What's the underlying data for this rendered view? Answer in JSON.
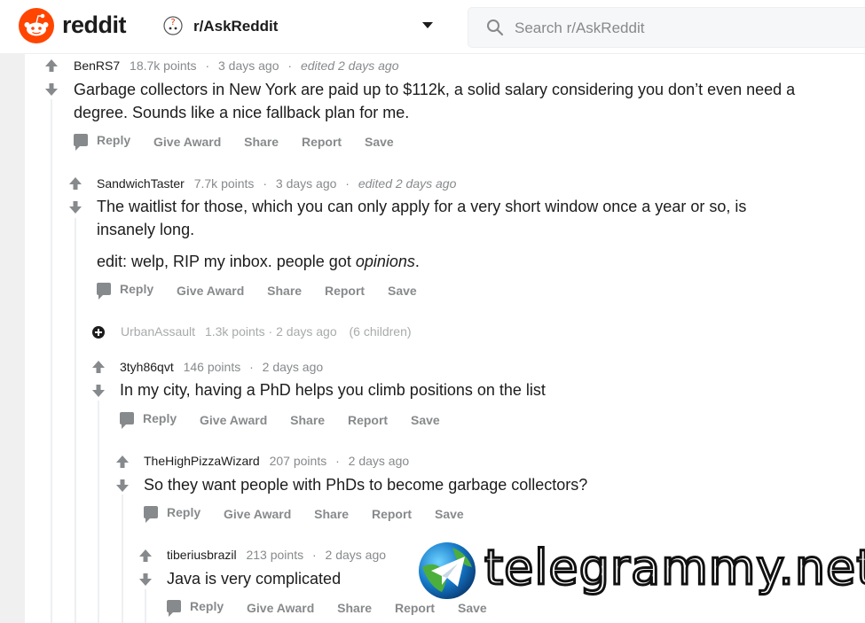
{
  "header": {
    "wordmark": "reddit",
    "subreddit": "r/AskReddit",
    "search_placeholder": "Search r/AskReddit"
  },
  "comments": [
    {
      "author": "BenRS7",
      "points": "18.7k points",
      "time": "3 days ago",
      "edited": "edited 2 days ago",
      "body": "Garbage collectors in New York are paid up to $112k, a solid salary considering you don’t even need a degree. Sounds like a nice fallback plan for me."
    },
    {
      "author": "SandwichTaster",
      "points": "7.7k points",
      "time": "3 days ago",
      "edited": "edited 2 days ago",
      "body": "The waitlist for those, which you can only apply for a very short window once a year or so, is insanely long.",
      "body2_prefix": "edit: welp, RIP my inbox. people got ",
      "body2_em": "opinions",
      "body2_suffix": "."
    },
    {
      "author": "UrbanAssault",
      "points": "1.3k points",
      "time": "2 days ago",
      "children": "(6 children)"
    },
    {
      "author": "3tyh86qvt",
      "points": "146 points",
      "time": "2 days ago",
      "body": "In my city, having a PhD helps you climb positions on the list"
    },
    {
      "author": "TheHighPizzaWizard",
      "points": "207 points",
      "time": "2 days ago",
      "body": "So they want people with PhDs to become garbage collectors?"
    },
    {
      "author": "tiberiusbrazil",
      "points": "213 points",
      "time": "2 days ago",
      "body": "Java is very complicated"
    }
  ],
  "actions": {
    "reply": "Reply",
    "give_award": "Give Award",
    "share": "Share",
    "report": "Report",
    "save": "Save"
  },
  "meta_sep": "·",
  "watermark": "telegrammy.net",
  "colors": {
    "brand": "#ff4500",
    "muted": "#878a8c",
    "text": "#1c1c1c"
  }
}
